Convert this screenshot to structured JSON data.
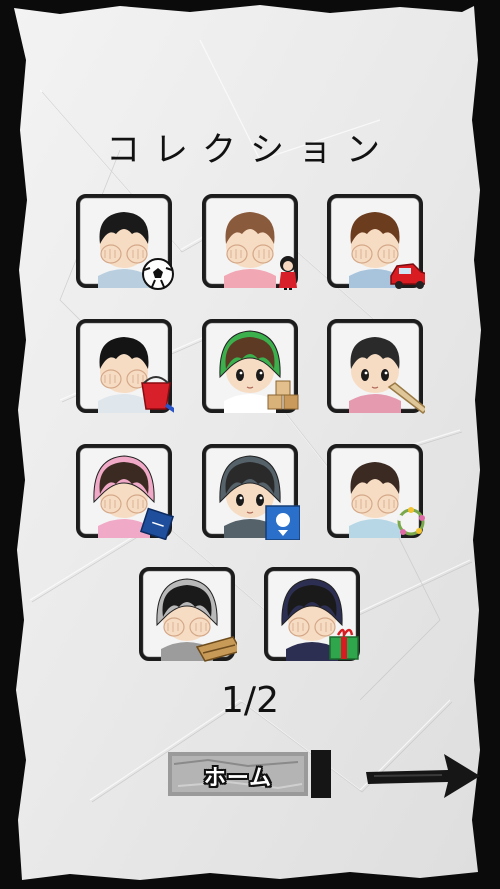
{
  "screen": {
    "title": "コレクション",
    "page_indicator": "1/2"
  },
  "navigation": {
    "home_label": "ホーム",
    "next_icon": "arrow-right-icon"
  },
  "colors": {
    "paper": "#ececec",
    "ink": "#111111",
    "frame": "#1c1c1c",
    "background": "#0b0b0b"
  },
  "collection": {
    "items": [
      {
        "hair": "#1a1a1a",
        "hat": "",
        "shirt": "#b9cfe0",
        "eyes": "covered",
        "item_icon": "soccer-ball-icon"
      },
      {
        "hair": "#8a5a3c",
        "hat": "",
        "shirt": "#f2a7b4",
        "eyes": "covered",
        "item_icon": "doll-icon"
      },
      {
        "hair": "#6b3c1e",
        "hat": "",
        "shirt": "#a8c4dd",
        "eyes": "covered",
        "item_icon": "toy-car-icon"
      },
      {
        "hair": "#141414",
        "hat": "",
        "shirt": "#dfe6ec",
        "eyes": "covered",
        "item_icon": "bucket-icon"
      },
      {
        "hair": "#5c3a24",
        "hat": "#3bb04d",
        "shirt": "#ffffff",
        "eyes": "open",
        "item_icon": "wooden-blocks-icon"
      },
      {
        "hair": "#2a2a2a",
        "hat": "",
        "shirt": "#e59ab0",
        "eyes": "open",
        "item_icon": "bat-icon"
      },
      {
        "hair": "#3a2a22",
        "hat": "#f0a9c6",
        "shirt": "#f0a9c6",
        "eyes": "covered",
        "item_icon": "book-icon"
      },
      {
        "hair": "#2a2a2a",
        "hat": "#56626a",
        "shirt": "#56626a",
        "eyes": "open",
        "item_icon": "photo-card-icon"
      },
      {
        "hair": "#3a2a22",
        "hat": "",
        "shirt": "#b7d7e6",
        "eyes": "covered",
        "item_icon": "flower-wreath-icon"
      },
      {
        "hair": "#1a1a1a",
        "hat": "#b9b9b9",
        "shirt": "#9c9c9c",
        "eyes": "covered",
        "item_icon": "wooden-box-icon"
      },
      {
        "hair": "#1a1a1a",
        "hat": "#2d2f52",
        "shirt": "#2d2f52",
        "eyes": "covered",
        "item_icon": "gift-box-icon"
      }
    ]
  }
}
